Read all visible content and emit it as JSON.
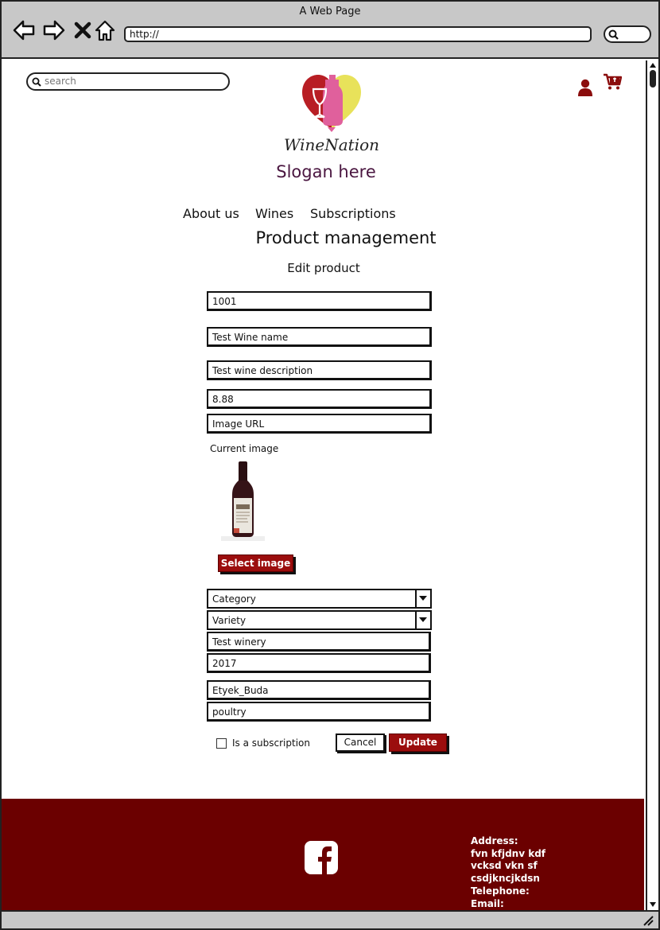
{
  "window": {
    "title": "A Web Page",
    "url": "http://"
  },
  "header": {
    "search_placeholder": "search",
    "brand": "WineNation",
    "slogan": "Slogan here"
  },
  "nav": {
    "items": [
      "About us",
      "Wines",
      "Subscriptions"
    ]
  },
  "page": {
    "title": "Product management",
    "subtitle": "Edit product"
  },
  "form": {
    "id": "1001",
    "name": "Test Wine name",
    "description": "Test wine description",
    "price": "8.88",
    "image_url": "Image URL",
    "current_image_label": "Current image",
    "select_image_label": "Select image",
    "category": "Category",
    "variety": "Variety",
    "winery": "Test winery",
    "year": "2017",
    "region": "Etyek_Buda",
    "pairing": "poultry",
    "subscription_label": "Is a subscription",
    "cancel_label": "Cancel",
    "update_label": "Update"
  },
  "footer": {
    "address_lines": [
      "Address:",
      "fvn kfjdnv kdf",
      "vcksd vkn sf",
      "csdjkncjkdsn",
      "Telephone:",
      "Email:"
    ]
  },
  "icons": {
    "back": "back-arrow-icon",
    "forward": "forward-arrow-icon",
    "stop": "close-icon",
    "home": "home-icon",
    "search": "search-icon",
    "user": "user-icon",
    "cart": "cart-icon",
    "facebook": "facebook-icon"
  },
  "colors": {
    "brand": "#9b0d0d",
    "footer": "#6b0000",
    "slogan": "#4a1640"
  }
}
